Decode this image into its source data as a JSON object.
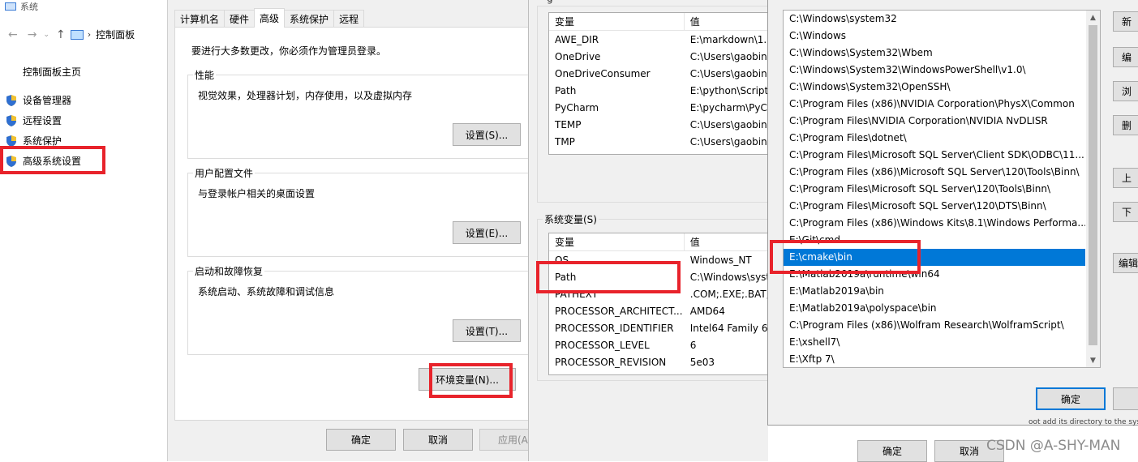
{
  "control_panel": {
    "window_title": "系统",
    "address": "控制面板",
    "home_link": "控制面板主页",
    "links": [
      "设备管理器",
      "远程设置",
      "系统保护",
      "高级系统设置"
    ]
  },
  "system_properties": {
    "tabs": [
      "计算机名",
      "硬件",
      "高级",
      "系统保护",
      "远程"
    ],
    "active_tab": "高级",
    "admin_note": "要进行大多数更改，你必须作为管理员登录。",
    "performance": {
      "title": "性能",
      "desc": "视觉效果，处理器计划，内存使用，以及虚拟内存",
      "button": "设置(S)..."
    },
    "user_profiles": {
      "title": "用户配置文件",
      "desc": "与登录帐户相关的桌面设置",
      "button": "设置(E)..."
    },
    "startup_recovery": {
      "title": "启动和故障恢复",
      "desc": "系统启动、系统故障和调试信息",
      "button": "设置(T)..."
    },
    "env_button": "环境变量(N)...",
    "ok": "确定",
    "cancel": "取消",
    "apply": "应用(A)"
  },
  "environment_variables": {
    "header_fragment": "g",
    "user_vars": {
      "columns": [
        "变量",
        "值"
      ],
      "rows": [
        [
          "AWE_DIR",
          "E:\\markdown\\1."
        ],
        [
          "OneDrive",
          "C:\\Users\\gaobin"
        ],
        [
          "OneDriveConsumer",
          "C:\\Users\\gaobin"
        ],
        [
          "Path",
          "E:\\python\\Script"
        ],
        [
          "PyCharm",
          "E:\\pycharm\\PyC"
        ],
        [
          "TEMP",
          "C:\\Users\\gaobin"
        ],
        [
          "TMP",
          "C:\\Users\\gaobin"
        ]
      ]
    },
    "system_label": "系统变量(S)",
    "system_vars": {
      "columns": [
        "变量",
        "值"
      ],
      "rows": [
        [
          "OS",
          "Windows_NT"
        ],
        [
          "Path",
          "C:\\Windows\\syst"
        ],
        [
          "PATHEXT",
          ".COM;.EXE;.BAT;"
        ],
        [
          "PROCESSOR_ARCHITECT...",
          "AMD64"
        ],
        [
          "PROCESSOR_IDENTIFIER",
          "Intel64 Family 6"
        ],
        [
          "PROCESSOR_LEVEL",
          "6"
        ],
        [
          "PROCESSOR_REVISION",
          "5e03"
        ]
      ]
    },
    "ok": "确定",
    "cancel": "取消"
  },
  "edit_path": {
    "entries": [
      "C:\\Windows\\system32",
      "C:\\Windows",
      "C:\\Windows\\System32\\Wbem",
      "C:\\Windows\\System32\\WindowsPowerShell\\v1.0\\",
      "C:\\Windows\\System32\\OpenSSH\\",
      "C:\\Program Files (x86)\\NVIDIA Corporation\\PhysX\\Common",
      "C:\\Program Files\\NVIDIA Corporation\\NVIDIA NvDLISR",
      "C:\\Program Files\\dotnet\\",
      "C:\\Program Files\\Microsoft SQL Server\\Client SDK\\ODBC\\11...",
      "C:\\Program Files (x86)\\Microsoft SQL Server\\120\\Tools\\Binn\\",
      "C:\\Program Files\\Microsoft SQL Server\\120\\Tools\\Binn\\",
      "C:\\Program Files\\Microsoft SQL Server\\120\\DTS\\Binn\\",
      "C:\\Program Files (x86)\\Windows Kits\\8.1\\Windows Performa...",
      "E:\\Git\\cmd",
      "E:\\cmake\\bin",
      "E:\\Matlab2019a\\runtime\\win64",
      "E:\\Matlab2019a\\bin",
      "E:\\Matlab2019a\\polyspace\\bin",
      "C:\\Program Files (x86)\\Wolfram Research\\WolframScript\\",
      "E:\\xshell7\\",
      "E:\\Xftp 7\\"
    ],
    "selected": "E:\\cmake\\bin",
    "side_buttons": [
      "新",
      "编",
      "浏",
      "删",
      "上",
      "下",
      "编辑"
    ],
    "ok": "确定",
    "bottom_fragment": "oot add its directory to the system"
  },
  "watermark": "CSDN @A-SHY-MAN",
  "colors": {
    "highlight_red": "#e8232b",
    "selection_blue": "#0078d7"
  }
}
